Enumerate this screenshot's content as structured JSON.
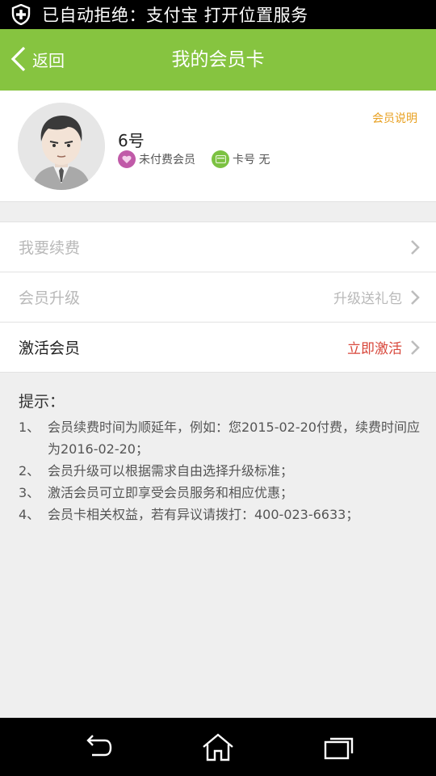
{
  "status_bar": {
    "text": "已自动拒绝：支付宝 打开位置服务"
  },
  "header": {
    "back_label": "返回",
    "title": "我的会员卡"
  },
  "profile": {
    "member_note": "会员说明",
    "username": "6号",
    "status_badge": "未付费会员",
    "card_number": "卡号 无"
  },
  "menu": {
    "items": [
      {
        "label": "我要续费",
        "extra": ""
      },
      {
        "label": "会员升级",
        "extra": "升级送礼包"
      },
      {
        "label": "激活会员",
        "extra": "立即激活"
      }
    ]
  },
  "tips": {
    "title": "提示：",
    "items": [
      {
        "num": "1、",
        "text": "会员续费时间为顺延年，例如：您2015-02-20付费，续费时间应为2016-02-20；"
      },
      {
        "num": "2、",
        "text": "会员升级可以根据需求自由选择升级标准；"
      },
      {
        "num": "3、",
        "text": "激活会员可立即享受会员服务和相应优惠；"
      },
      {
        "num": "4、",
        "text": "会员卡相关权益，若有异议请拨打：400-023-6633；"
      }
    ]
  },
  "colors": {
    "header_green": "#86c440",
    "accent_orange": "#e8a020",
    "accent_red": "#d8473b"
  }
}
